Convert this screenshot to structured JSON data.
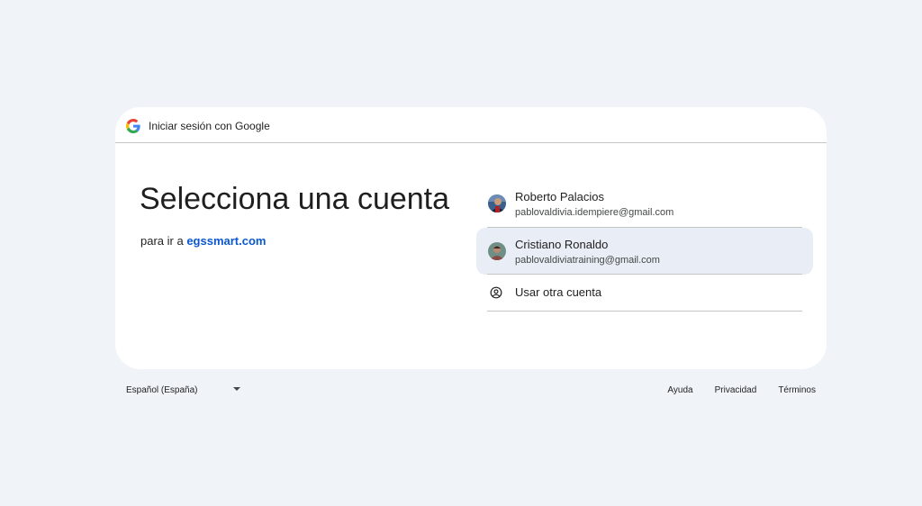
{
  "header": {
    "title": "Iniciar sesión con Google",
    "logo_icon": "google-g-icon"
  },
  "main": {
    "heading": "Selecciona una cuenta",
    "subline_prefix": "para ir a",
    "subline_link": "egssmart.com"
  },
  "accounts": [
    {
      "name": "Roberto Palacios",
      "email": "pablovaldivia.idempiere@gmail.com",
      "avatar_icon": "profile-photo-icon"
    },
    {
      "name": "Cristiano Ronaldo",
      "email": "pablovaldiviatraining@gmail.com",
      "avatar_icon": "profile-photo-icon",
      "hovered": true
    }
  ],
  "other_account": {
    "label": "Usar otra cuenta",
    "icon": "account-circle-icon"
  },
  "footer": {
    "language": "Español (España)",
    "links": [
      "Ayuda",
      "Privacidad",
      "Términos"
    ]
  },
  "colors": {
    "page_bg": "#f0f4f9",
    "card_bg": "#ffffff",
    "link": "#0b57d0",
    "hover_row": "#e9eef6",
    "divider": "#c4c7c5"
  }
}
